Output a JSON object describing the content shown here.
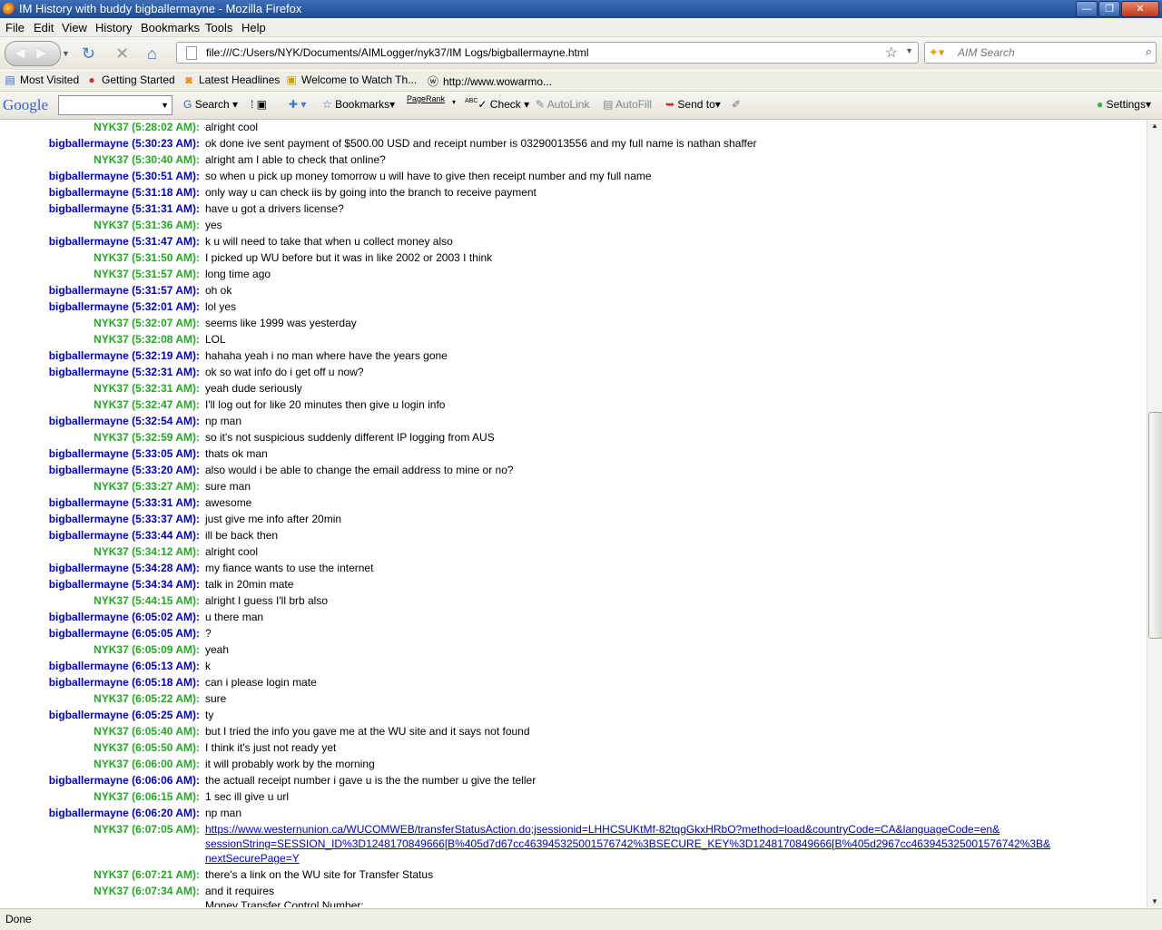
{
  "window": {
    "title": "IM History with buddy bigballermayne - Mozilla Firefox"
  },
  "menu": [
    "File",
    "Edit",
    "View",
    "History",
    "Bookmarks",
    "Tools",
    "Help"
  ],
  "nav": {
    "url": "file:///C:/Users/NYK/Documents/AIMLogger/nyk37/IM Logs/bigballermayne.html",
    "search_placeholder": "AIM Search"
  },
  "bookmarks": [
    "Most Visited",
    "Getting Started",
    "Latest Headlines",
    "Welcome to Watch Th...",
    "http://www.wowarmo..."
  ],
  "google_toolbar": {
    "logo": "Google",
    "search": "Search",
    "bookmarks": "Bookmarks",
    "pagerank": "PageRank",
    "abc": "ABC",
    "check": "Check",
    "autolink": "AutoLink",
    "autofill": "AutoFill",
    "sendto": "Send to",
    "settings": "Settings"
  },
  "messages": [
    {
      "who": "NYK37",
      "time": "(5:28:02 AM):",
      "text": "alright cool",
      "me": true
    },
    {
      "who": "bigballermayne",
      "time": "(5:30:23 AM):",
      "text": "ok done ive sent payment of $500.00 USD and receipt number is 03290013556 and my full name is nathan shaffer",
      "me": false
    },
    {
      "who": "NYK37",
      "time": "(5:30:40 AM):",
      "text": "alright am I able to check that online?",
      "me": true
    },
    {
      "who": "bigballermayne",
      "time": "(5:30:51 AM):",
      "text": "so when u pick up money tomorrow u will have to give then receipt number and my full name",
      "me": false
    },
    {
      "who": "bigballermayne",
      "time": "(5:31:18 AM):",
      "text": "only way u can check iis by going into the branch to receive payment",
      "me": false
    },
    {
      "who": "bigballermayne",
      "time": "(5:31:31 AM):",
      "text": "have u got a drivers license?",
      "me": false
    },
    {
      "who": "NYK37",
      "time": "(5:31:36 AM):",
      "text": "yes",
      "me": true
    },
    {
      "who": "bigballermayne",
      "time": "(5:31:47 AM):",
      "text": "k u will need to take that when u collect money also",
      "me": false
    },
    {
      "who": "NYK37",
      "time": "(5:31:50 AM):",
      "text": "I picked up WU before but it was in like 2002 or 2003 I think",
      "me": true
    },
    {
      "who": "NYK37",
      "time": "(5:31:57 AM):",
      "text": "long time ago",
      "me": true
    },
    {
      "who": "bigballermayne",
      "time": "(5:31:57 AM):",
      "text": "oh ok",
      "me": false
    },
    {
      "who": "bigballermayne",
      "time": "(5:32:01 AM):",
      "text": "lol yes",
      "me": false
    },
    {
      "who": "NYK37",
      "time": "(5:32:07 AM):",
      "text": "seems like 1999 was yesterday",
      "me": true
    },
    {
      "who": "NYK37",
      "time": "(5:32:08 AM):",
      "text": "LOL",
      "me": true
    },
    {
      "who": "bigballermayne",
      "time": "(5:32:19 AM):",
      "text": "hahaha yeah i no man where have the years gone",
      "me": false
    },
    {
      "who": "bigballermayne",
      "time": "(5:32:31 AM):",
      "text": "ok so wat info do i get off u now?",
      "me": false
    },
    {
      "who": "NYK37",
      "time": "(5:32:31 AM):",
      "text": "yeah dude seriously",
      "me": true
    },
    {
      "who": "NYK37",
      "time": "(5:32:47 AM):",
      "text": "I'll log out for like 20 minutes then give u login info",
      "me": true
    },
    {
      "who": "bigballermayne",
      "time": "(5:32:54 AM):",
      "text": "np man",
      "me": false
    },
    {
      "who": "NYK37",
      "time": "(5:32:59 AM):",
      "text": "so it's not suspicious suddenly different IP logging from AUS",
      "me": true
    },
    {
      "who": "bigballermayne",
      "time": "(5:33:05 AM):",
      "text": "thats ok man",
      "me": false
    },
    {
      "who": "bigballermayne",
      "time": "(5:33:20 AM):",
      "text": "also would i be able to change the email address to mine or no?",
      "me": false
    },
    {
      "who": "NYK37",
      "time": "(5:33:27 AM):",
      "text": "sure man",
      "me": true
    },
    {
      "who": "bigballermayne",
      "time": "(5:33:31 AM):",
      "text": "awesome",
      "me": false
    },
    {
      "who": "bigballermayne",
      "time": "(5:33:37 AM):",
      "text": "just give me info after 20min",
      "me": false
    },
    {
      "who": "bigballermayne",
      "time": "(5:33:44 AM):",
      "text": "ill be back then",
      "me": false
    },
    {
      "who": "NYK37",
      "time": "(5:34:12 AM):",
      "text": "alright cool",
      "me": true
    },
    {
      "who": "bigballermayne",
      "time": "(5:34:28 AM):",
      "text": "my fiance wants to use the internet",
      "me": false
    },
    {
      "who": "bigballermayne",
      "time": "(5:34:34 AM):",
      "text": "talk in 20min mate",
      "me": false
    },
    {
      "who": "NYK37",
      "time": "(5:44:15 AM):",
      "text": "alright I guess I'll brb also",
      "me": true
    },
    {
      "who": "bigballermayne",
      "time": "(6:05:02 AM):",
      "text": "u there man",
      "me": false
    },
    {
      "who": "bigballermayne",
      "time": "(6:05:05 AM):",
      "text": "?",
      "me": false
    },
    {
      "who": "NYK37",
      "time": "(6:05:09 AM):",
      "text": "yeah",
      "me": true
    },
    {
      "who": "bigballermayne",
      "time": "(6:05:13 AM):",
      "text": "k",
      "me": false
    },
    {
      "who": "bigballermayne",
      "time": "(6:05:18 AM):",
      "text": "can i please login mate",
      "me": false
    },
    {
      "who": "NYK37",
      "time": "(6:05:22 AM):",
      "text": "sure",
      "me": true
    },
    {
      "who": "bigballermayne",
      "time": "(6:05:25 AM):",
      "text": "ty",
      "me": false
    },
    {
      "who": "NYK37",
      "time": "(6:05:40 AM):",
      "text": "but I tried the info you gave me at the WU site and it says not found",
      "me": true
    },
    {
      "who": "NYK37",
      "time": "(6:05:50 AM):",
      "text": "I think it's just not ready yet",
      "me": true
    },
    {
      "who": "NYK37",
      "time": "(6:06:00 AM):",
      "text": "it will probably work by the morning",
      "me": true
    },
    {
      "who": "bigballermayne",
      "time": "(6:06:06 AM):",
      "text": "the actuall receipt number i gave u is the the number u give the teller",
      "me": false
    },
    {
      "who": "NYK37",
      "time": "(6:06:15 AM):",
      "text": "1 sec ill give u url",
      "me": true
    },
    {
      "who": "bigballermayne",
      "time": "(6:06:20 AM):",
      "text": "np man",
      "me": false
    }
  ],
  "link_message": {
    "who": "NYK37",
    "time": "(6:07:05 AM):",
    "lines": [
      "https://www.westernunion.ca/WUCOMWEB/transferStatusAction.do;jsessionid=LHHCSUKtMf-82tqgGkxHRbO?method=load&countryCode=CA&languageCode=en&",
      "sessionString=SESSION_ID%3D1248170849666[B%405d7d67cc46394532500157674​2%3BSECURE_KEY%3D1248170849666[B%405d2967cc46394532500157674​2%3B&",
      "nextSecurePage=Y"
    ]
  },
  "tail_messages": [
    {
      "who": "NYK37",
      "time": "(6:07:21 AM):",
      "text": "there's a link on the WU site for Transfer Status",
      "me": true
    },
    {
      "who": "NYK37",
      "time": "(6:07:34 AM):",
      "text": "and it requires",
      "me": true
    },
    {
      "who": "",
      "time": "",
      "text": "Money Transfer Control Number:",
      "me": true
    }
  ],
  "status": {
    "text": "Done"
  }
}
